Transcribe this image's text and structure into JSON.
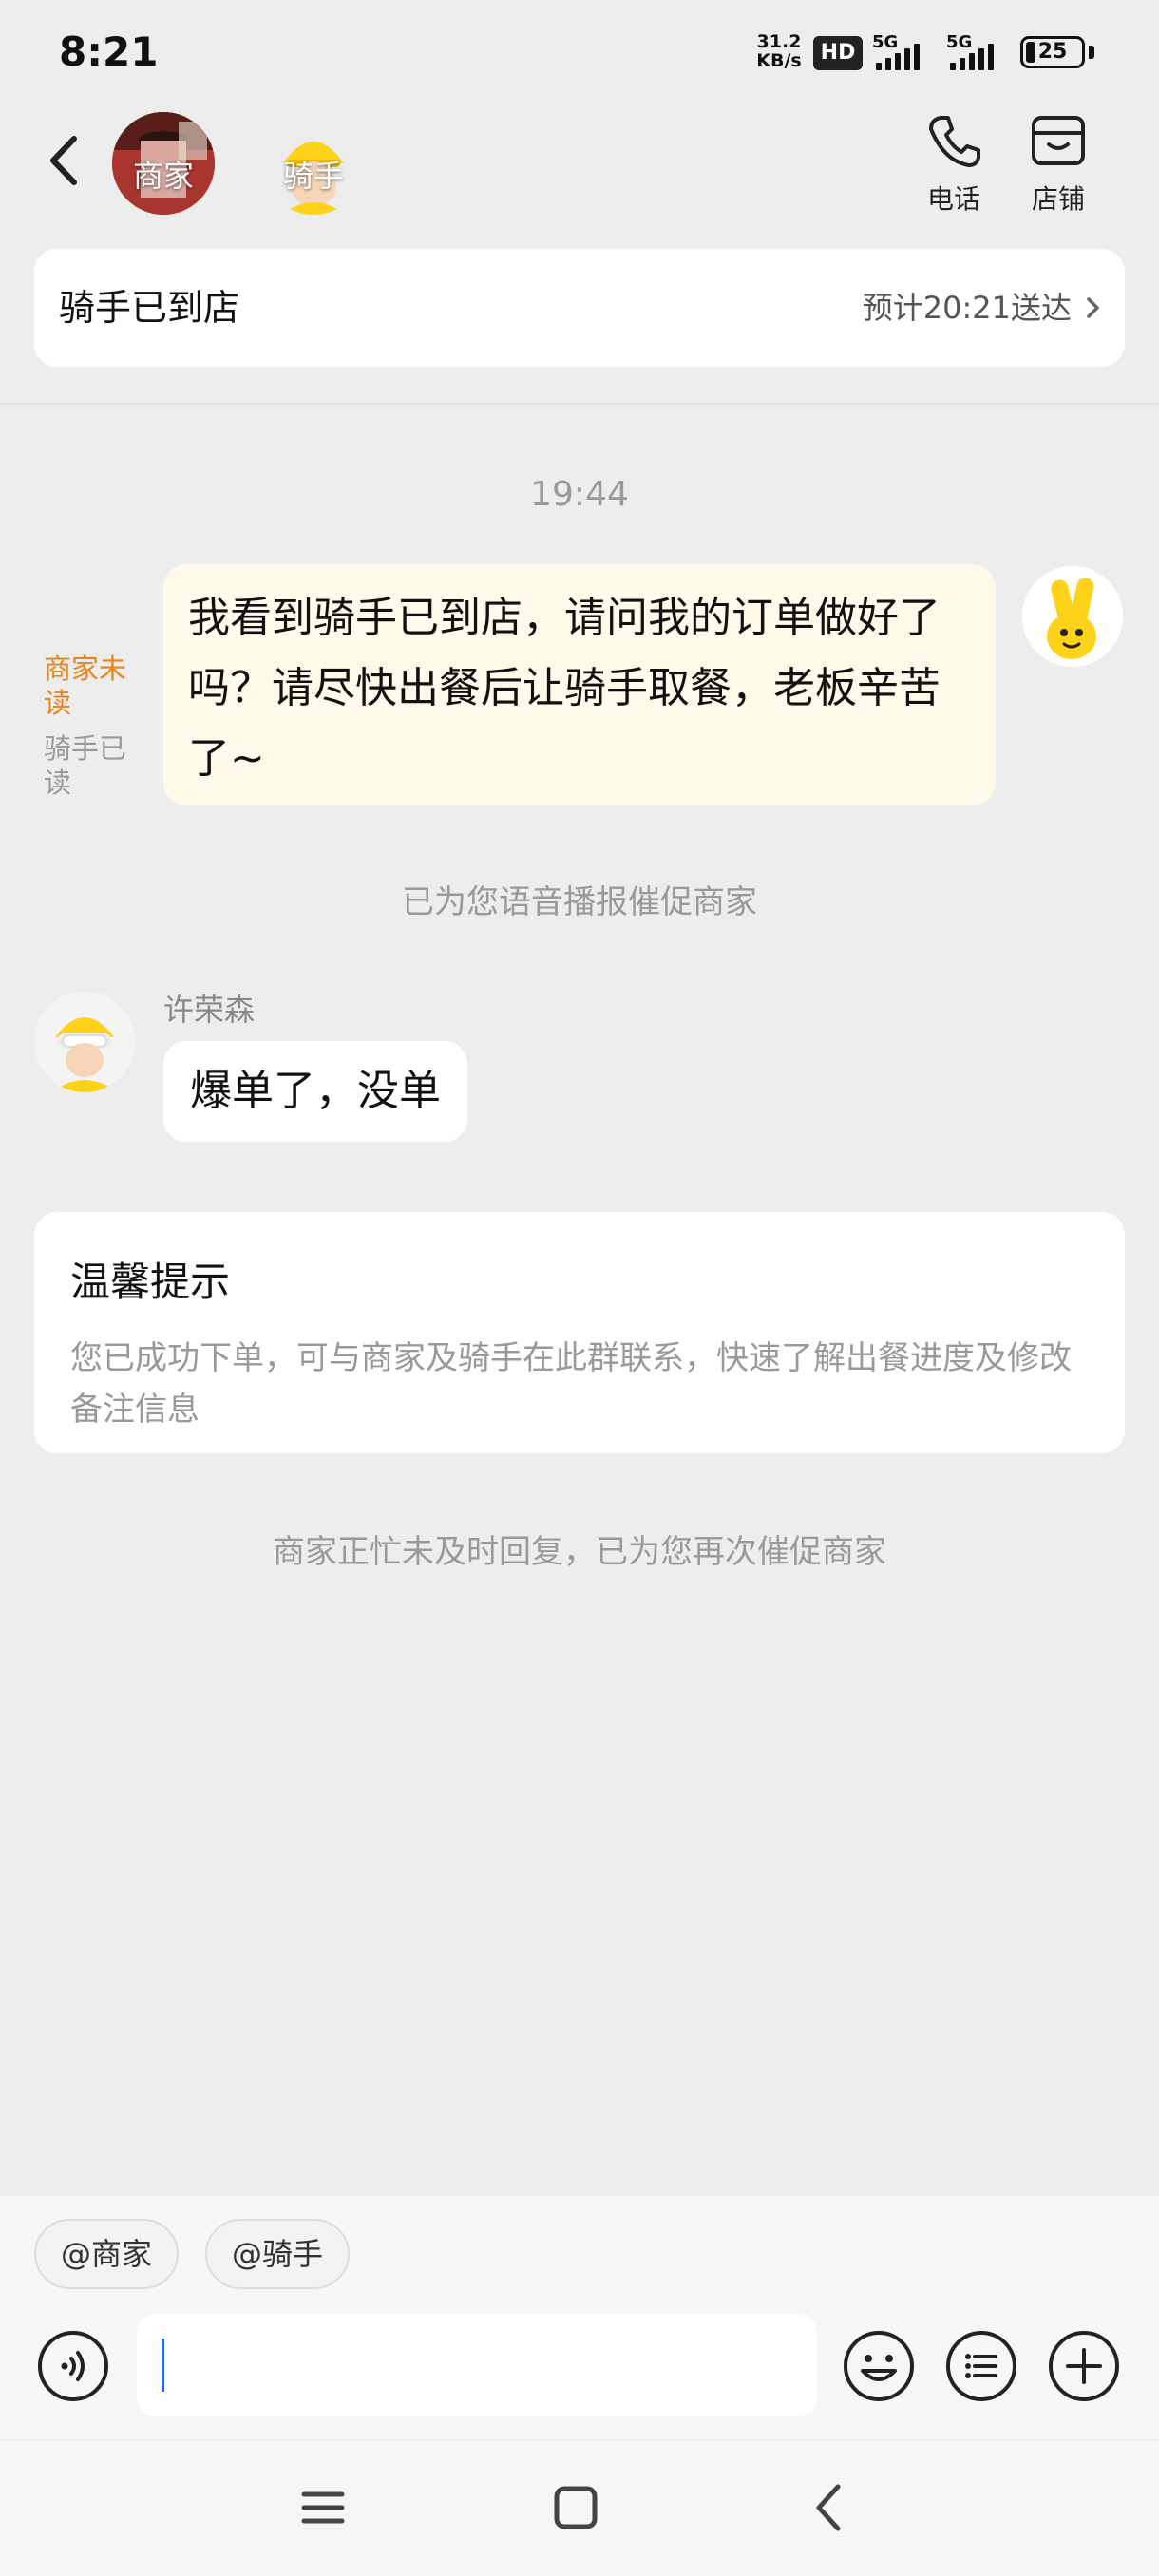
{
  "status_bar": {
    "time": "8:21",
    "net_speed_value": "31.2",
    "net_speed_unit": "KB/s",
    "hd_badge": "HD",
    "signal_1_label": "5G",
    "signal_2_label": "5G",
    "battery": "25"
  },
  "header": {
    "merchant_chip": "商家",
    "rider_chip": "骑手",
    "phone_label": "电话",
    "shop_label": "店铺"
  },
  "order_status": {
    "title": "骑手已到店",
    "eta": "预计20:21送达"
  },
  "chat": {
    "timestamp": "19:44",
    "my_message": "我看到骑手已到店，请问我的订单做好了吗？请尽快出餐后让骑手取餐，老板辛苦了~",
    "merchant_read_status": "商家未读",
    "rider_read_status": "骑手已读",
    "voice_notice": "已为您语音播报催促商家",
    "rider_name": "许荣森",
    "rider_message": "爆单了，没单",
    "tip_title": "温馨提示",
    "tip_body": "您已成功下单，可与商家及骑手在此群联系，快速了解出餐进度及修改备注信息",
    "final_notice": "商家正忙未及时回复，已为您再次催促商家"
  },
  "composer": {
    "mention_merchant": "@商家",
    "mention_rider": "@骑手",
    "input_value": ""
  },
  "icons": {
    "back": "chevron-left-icon",
    "phone": "phone-icon",
    "shop": "shop-icon",
    "eta_chevron": "chevron-right-icon",
    "voice": "voice-icon",
    "emoji": "emoji-icon",
    "quick_reply": "list-icon",
    "more": "plus-icon",
    "nav_menu": "menu-icon",
    "nav_home": "home-icon",
    "nav_back": "back-icon"
  },
  "colors": {
    "page_bg": "#EDEDED",
    "bubble_out": "#FFF9EA",
    "unread_orange": "#E8841A",
    "caret_blue": "#2E6BD6",
    "brand_yellow": "#FFD21A"
  }
}
